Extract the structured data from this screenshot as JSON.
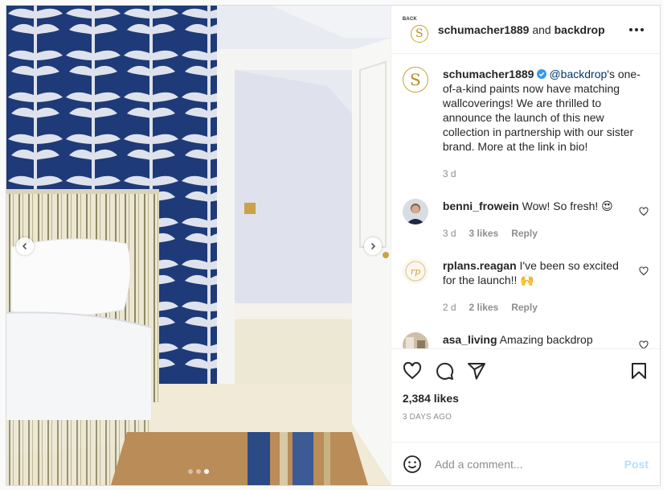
{
  "post": {
    "header": {
      "badge": "BACK",
      "logo_letter": "S",
      "owner": "schumacher1889",
      "joiner": "and",
      "collaborator": "backdrop"
    },
    "caption": {
      "username": "schumacher1889",
      "mention": "@backdrop",
      "text": "'s one-of-a-kind paints now have matching wallcoverings! We are thrilled to announce the launch of this new collection in partnership with our sister brand. More at the link in bio!",
      "age": "3 d"
    },
    "comments": [
      {
        "username": "benni_frowein",
        "text": "Wow! So fresh! 😍",
        "age": "3 d",
        "likes": "3 likes",
        "reply": "Reply"
      },
      {
        "username": "rplans.reagan",
        "text": "I've been so excited for the launch!! 🙌",
        "age": "2 d",
        "likes": "2 likes",
        "reply": "Reply"
      },
      {
        "username": "asa_living",
        "text": "Amazing backdrop"
      }
    ],
    "likes": "2,384 likes",
    "posted": "3 DAYS AGO",
    "add_comment": {
      "placeholder": "Add a comment...",
      "post_label": "Post"
    },
    "carousel": {
      "slides": 3,
      "active": 3
    }
  },
  "colors": {
    "wallpaper": "#1f3a78",
    "accent_link": "#00376b",
    "post_button": "#b2dffc",
    "verified": "#3897f0",
    "logo_gold": "#c9a431"
  },
  "icons": [
    "more-icon",
    "verified-icon",
    "heart-icon",
    "comment-icon",
    "share-icon",
    "save-icon",
    "emoji-icon",
    "chevron-left-icon",
    "chevron-right-icon"
  ]
}
